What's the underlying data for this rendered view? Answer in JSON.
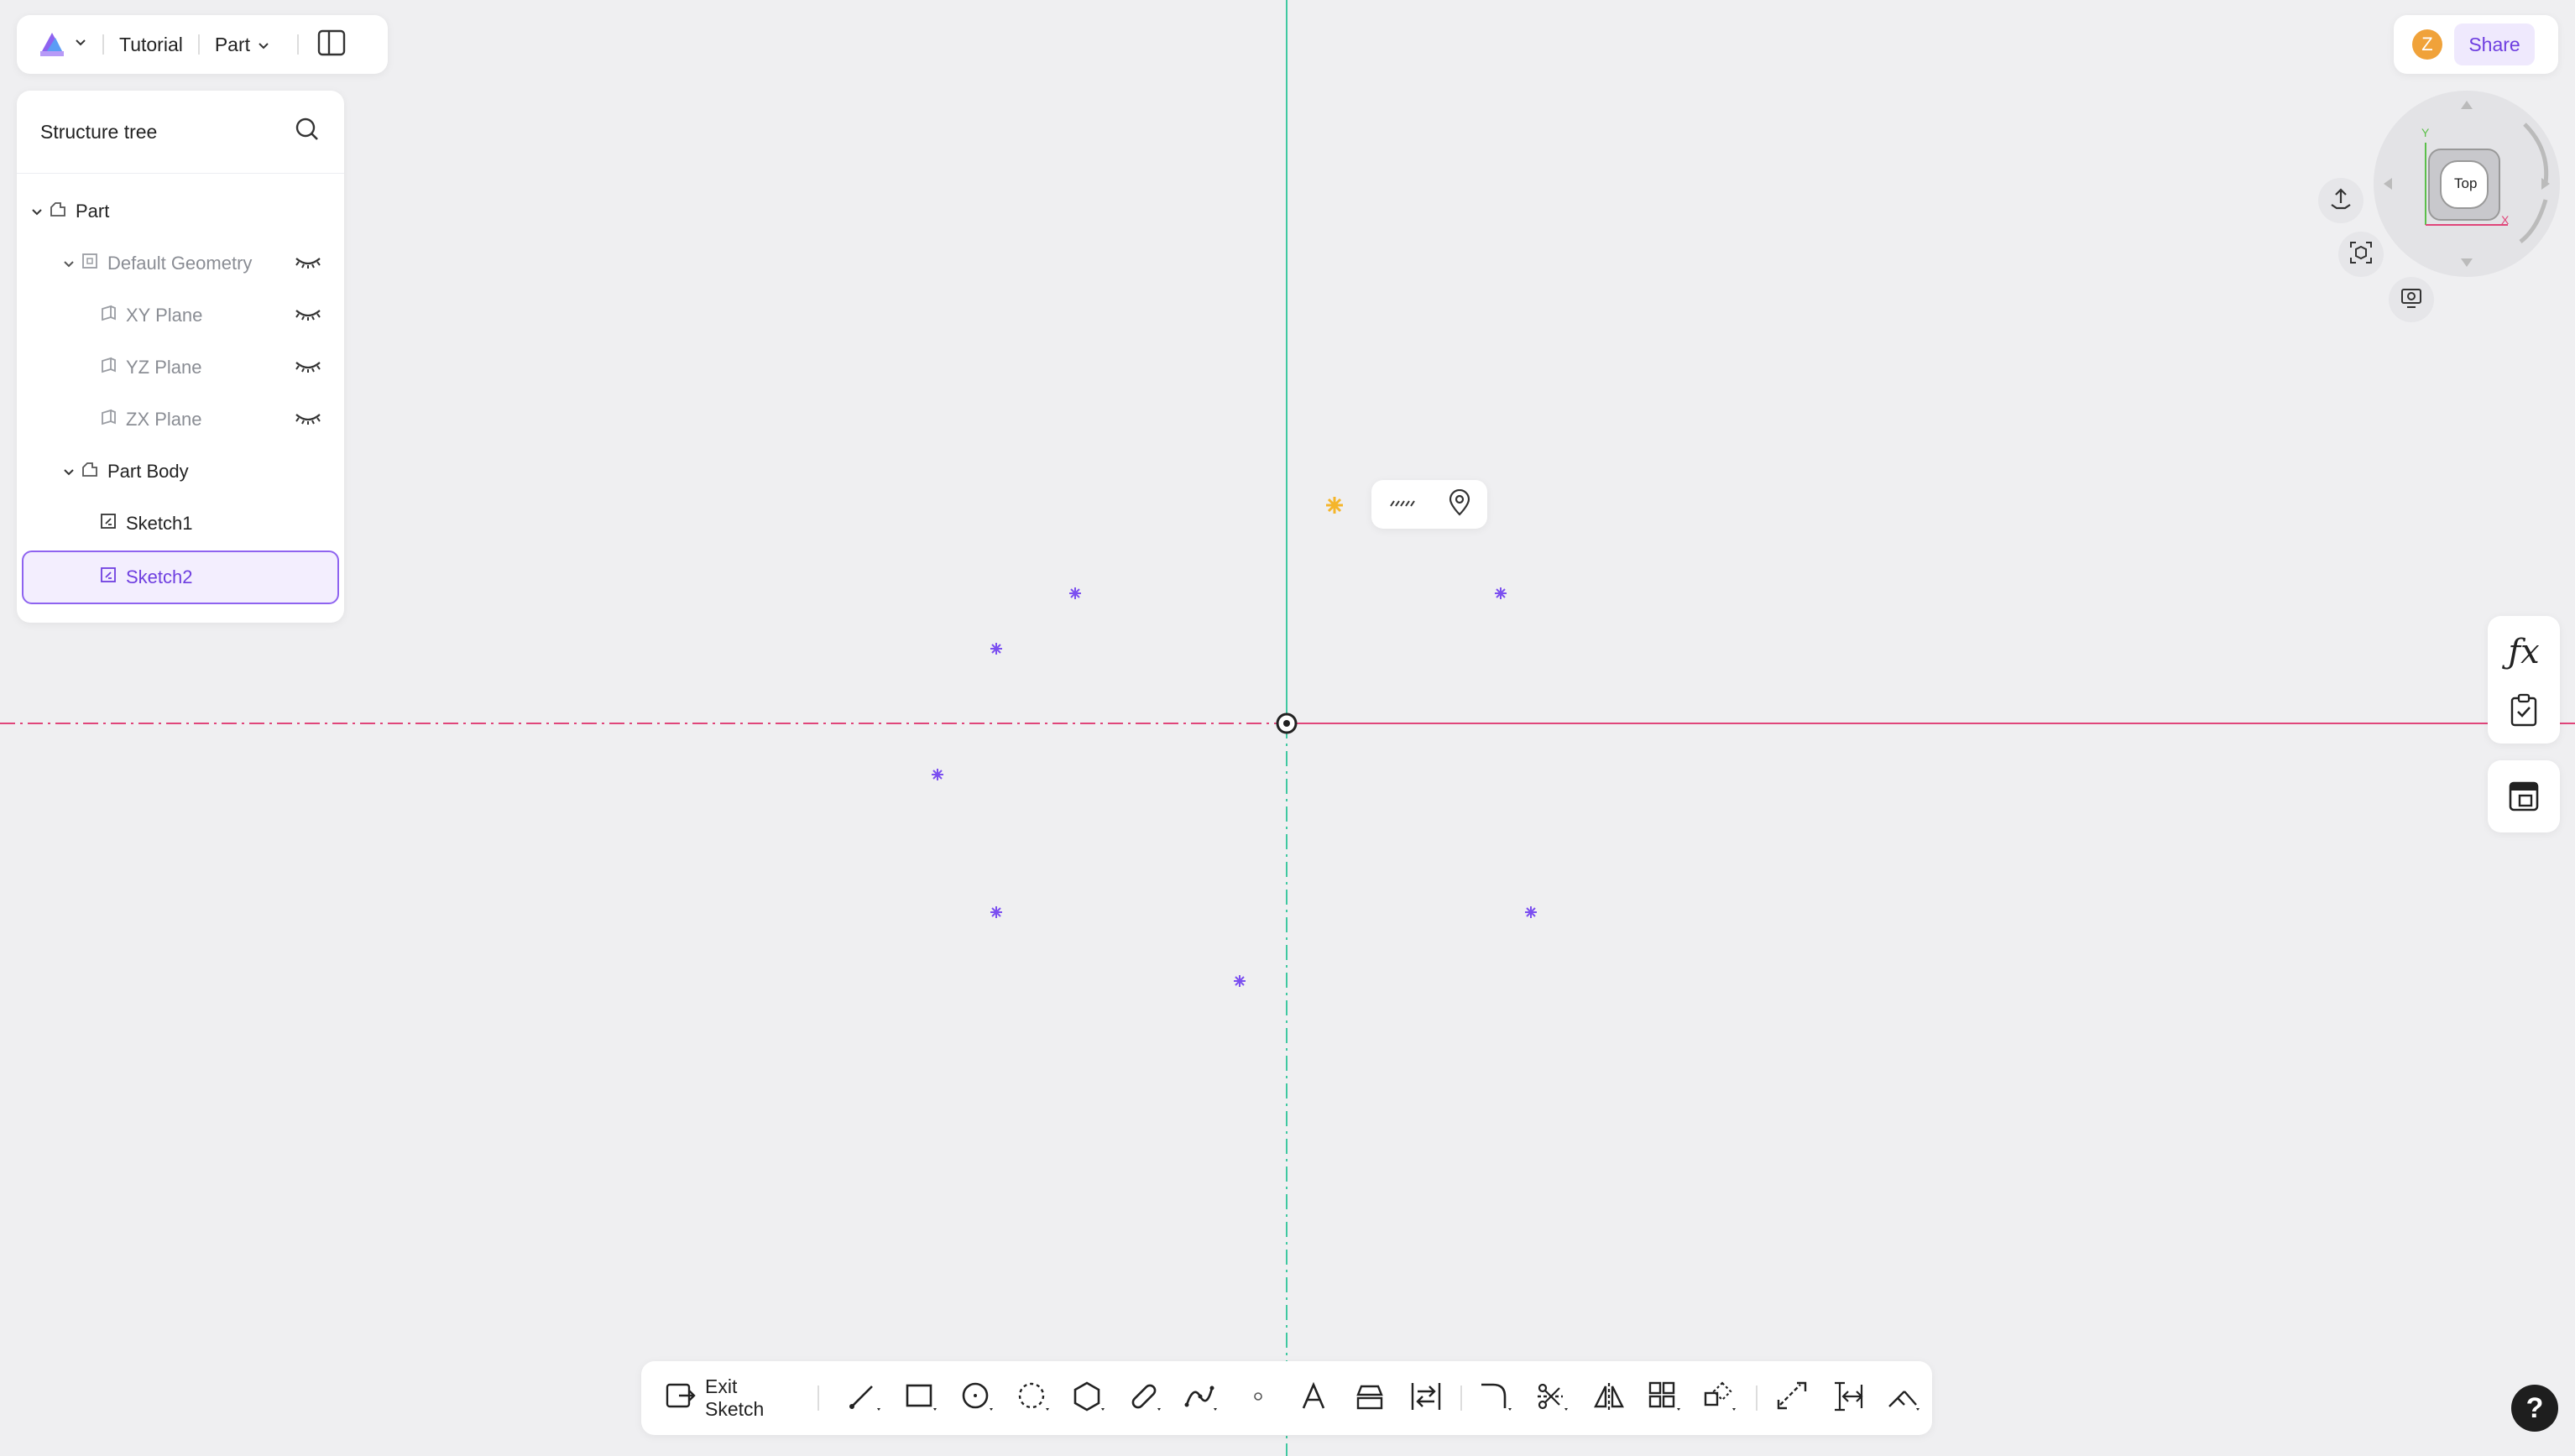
{
  "topbar": {
    "project": "Tutorial",
    "mode": "Part"
  },
  "tree": {
    "title": "Structure tree",
    "nodes": [
      {
        "label": "Part"
      },
      {
        "label": "Default Geometry"
      },
      {
        "label": "XY Plane"
      },
      {
        "label": "YZ Plane"
      },
      {
        "label": "ZX Plane"
      },
      {
        "label": "Part Body"
      },
      {
        "label": "Sketch1"
      },
      {
        "label": "Sketch2"
      }
    ]
  },
  "share": {
    "avatar_initial": "Z",
    "button": "Share"
  },
  "viewcube": {
    "face": "Top",
    "axis_x": "X",
    "axis_y": "Y"
  },
  "toolbar": {
    "exit_label": "Exit Sketch"
  },
  "help": {
    "label": "?"
  },
  "colors": {
    "accent": "#7b4ff0",
    "x_axis": "#e0457a",
    "y_axis": "#3fc8a0",
    "point": "#7b4ff0",
    "highlight_point": "#f5b52a"
  }
}
